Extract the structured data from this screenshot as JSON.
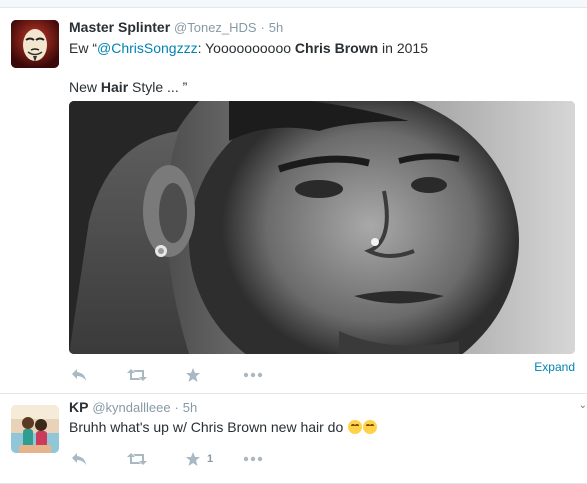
{
  "tweets": [
    {
      "fullname": "Master Splinter",
      "username": "@Tonez_HDS",
      "time": "5h",
      "line1_prefix": "Ew “",
      "line1_mention": "@ChrisSongzzz",
      "line1_mid": ": Yoooooooooo ",
      "line1_bold": "Chris Brown",
      "line1_suffix": " in 2015",
      "line2_prefix": "New ",
      "line2_bold": "Hair",
      "line2_suffix": " Style ... ”",
      "expand_label": "Expand",
      "fav_count": ""
    },
    {
      "fullname": "KP",
      "username": "@kyndallleee",
      "time": "5h",
      "text": "Bruhh what's up w/ Chris Brown new hair do ",
      "fav_count": "1"
    }
  ],
  "icons": {
    "reply": "reply-icon",
    "retweet": "retweet-icon",
    "favorite": "star-icon",
    "more": "more-icon"
  },
  "colors": {
    "link": "#0084b4",
    "muted": "#8899a6",
    "icon": "#aab8c2"
  }
}
